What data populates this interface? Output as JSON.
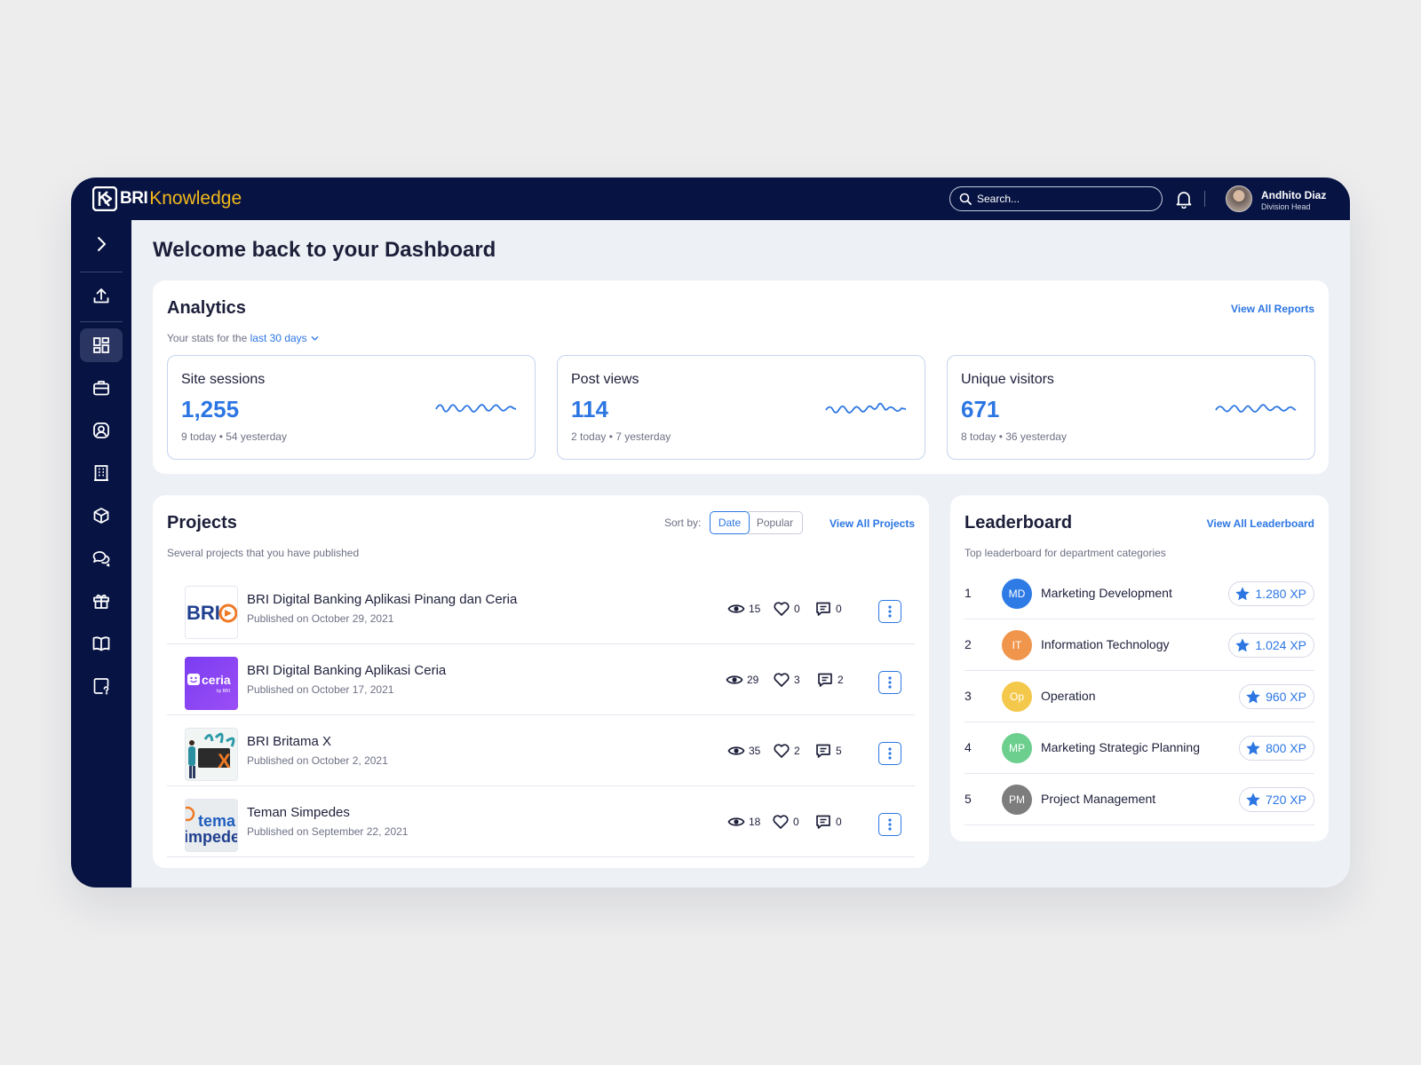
{
  "header": {
    "logo_bri": "BRI",
    "logo_knowledge": "Knowledge",
    "search_placeholder": "Search...",
    "user_name": "Andhito Diaz",
    "user_role": "Division Head"
  },
  "sidebar": {
    "items": [
      "expand",
      "upload",
      "dashboard",
      "briefcase",
      "profile",
      "building",
      "package",
      "chat",
      "gift",
      "book",
      "help"
    ],
    "active": "dashboard"
  },
  "page": {
    "title": "Welcome back to your Dashboard"
  },
  "analytics": {
    "title": "Analytics",
    "view_all": "View All Reports",
    "subtitle_prefix": "Your stats for the",
    "range": "last 30 days",
    "stats": [
      {
        "label": "Site sessions",
        "value": "1,255",
        "sub": "9 today • 54 yesterday"
      },
      {
        "label": "Post views",
        "value": "114",
        "sub": "2 today • 7 yesterday"
      },
      {
        "label": "Unique visitors",
        "value": "671",
        "sub": "8 today • 36 yesterday"
      }
    ]
  },
  "projects": {
    "title": "Projects",
    "subtitle": "Several projects that you have published",
    "sort_label": "Sort by:",
    "sort_options": [
      "Date",
      "Popular"
    ],
    "sort_selected": "Date",
    "view_all": "View All Projects",
    "items": [
      {
        "name": "BRI Digital Banking Aplikasi Pinang dan Ceria",
        "date": "Published on October 29, 2021",
        "views": "15",
        "likes": "0",
        "comments": "0",
        "thumb_text": "BRI"
      },
      {
        "name": "BRI Digital Banking Aplikasi Ceria",
        "date": "Published on October 17, 2021",
        "views": "29",
        "likes": "3",
        "comments": "2",
        "thumb_text": "ceria",
        "thumb_sub": "by BRI"
      },
      {
        "name": "BRI Britama X",
        "date": "Published on October 2, 2021",
        "views": "35",
        "likes": "2",
        "comments": "5",
        "thumb_text": "X"
      },
      {
        "name": "Teman Simpedes",
        "date": "Published on September 22, 2021",
        "views": "18",
        "likes": "0",
        "comments": "0",
        "thumb_text": "tema",
        "thumb_text2": "impede"
      }
    ]
  },
  "leaderboard": {
    "title": "Leaderboard",
    "subtitle": "Top leaderboard for department categories",
    "view_all": "View All Leaderboard",
    "items": [
      {
        "rank": "1",
        "initials": "MD",
        "name": "Marketing Development",
        "xp": "1.280 XP",
        "color": "#2f7be6"
      },
      {
        "rank": "2",
        "initials": "IT",
        "name": "Information Technology",
        "xp": "1.024 XP",
        "color": "#f0954c"
      },
      {
        "rank": "3",
        "initials": "Op",
        "name": "Operation",
        "xp": "960 XP",
        "color": "#f4c84a"
      },
      {
        "rank": "4",
        "initials": "MP",
        "name": "Marketing Strategic Planning",
        "xp": "800 XP",
        "color": "#6ccf8e"
      },
      {
        "rank": "5",
        "initials": "PM",
        "name": "Project Management",
        "xp": "720 XP",
        "color": "#7d7d7d"
      }
    ]
  },
  "colors": {
    "navy": "#071443",
    "accent": "#2c76e3",
    "logo_yellow": "#f3b91a"
  }
}
